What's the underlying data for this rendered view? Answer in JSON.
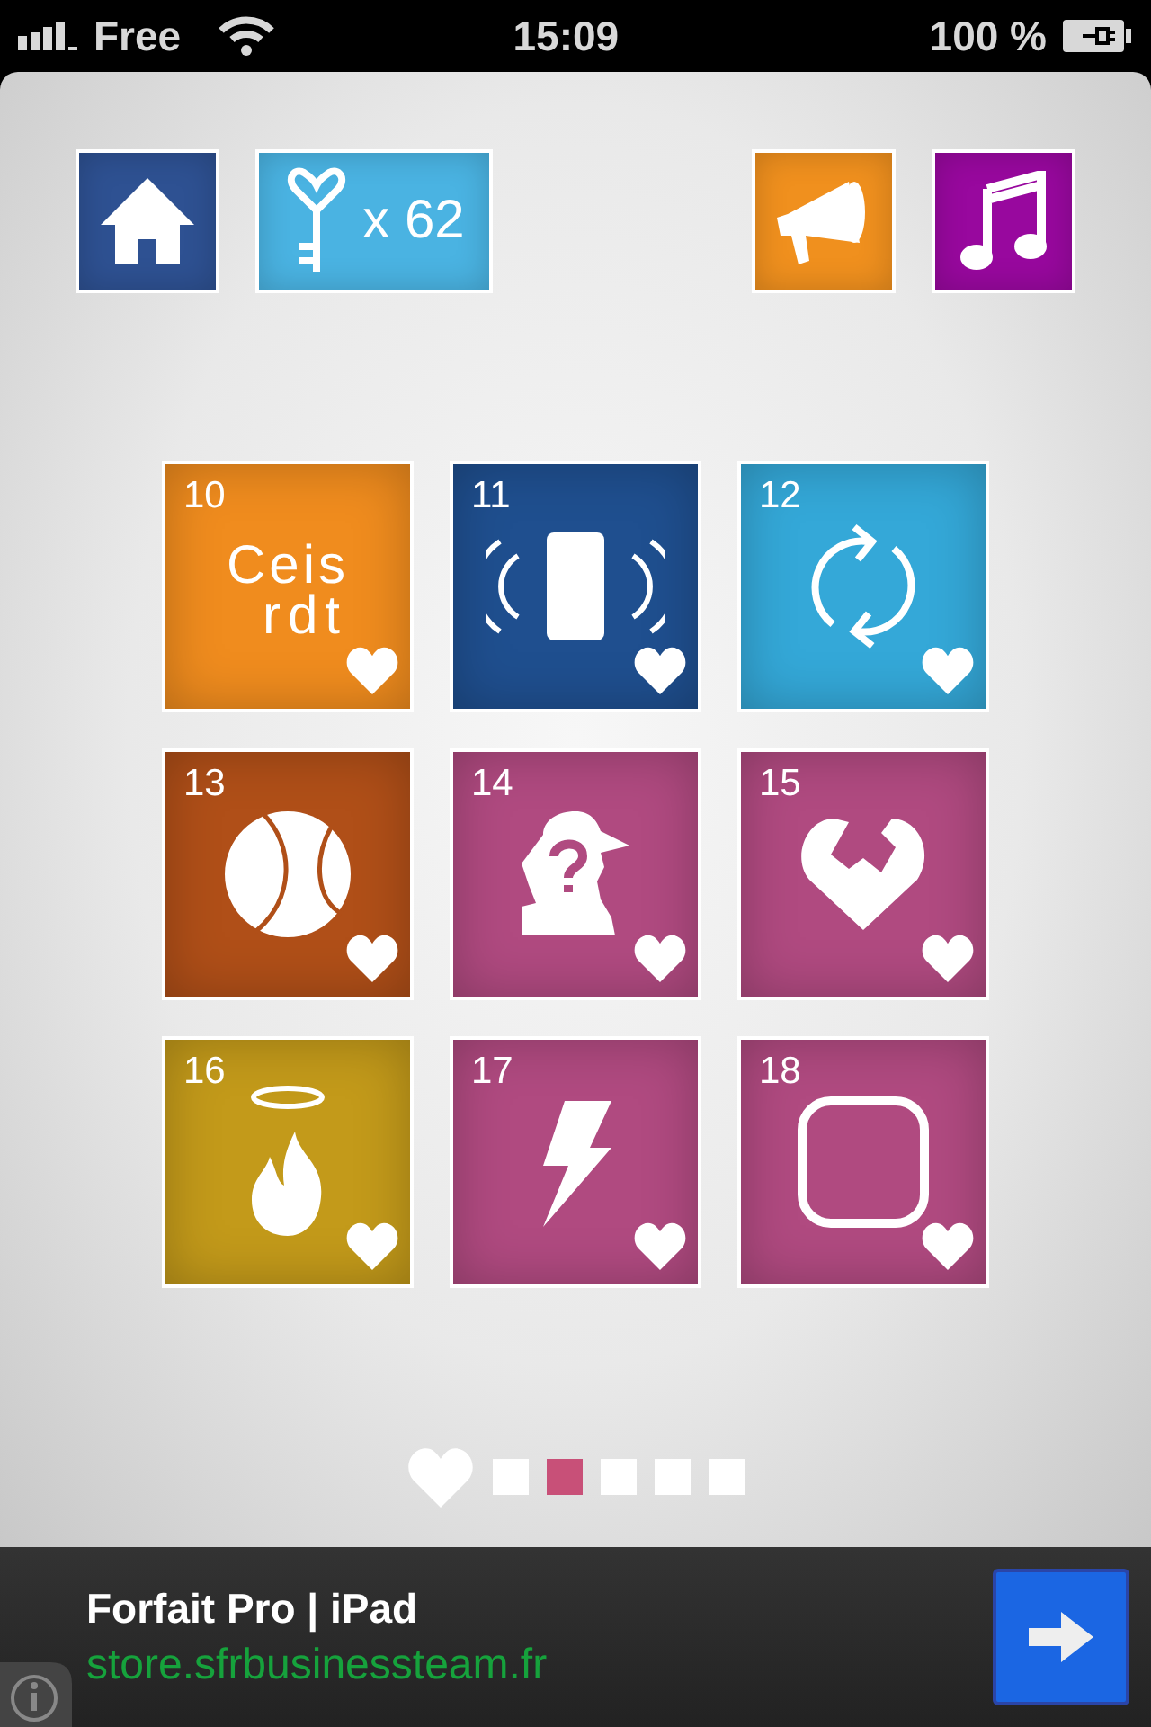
{
  "status_bar": {
    "carrier": "Free",
    "time": "15:09",
    "battery": "100 %"
  },
  "toolbar": {
    "left": [
      {
        "kind": "home",
        "color": "#2e5192"
      },
      {
        "kind": "keys",
        "color": "#4ab3e2",
        "count": "x 62"
      }
    ],
    "right": [
      {
        "kind": "megaphone",
        "color": "#f0901e"
      },
      {
        "kind": "music",
        "color": "#98089e"
      }
    ]
  },
  "tiles": [
    {
      "number": "10",
      "kind": "letters",
      "color": "#f08c1e",
      "letters": [
        "Ceis",
        "rdt"
      ]
    },
    {
      "number": "11",
      "kind": "vibrate",
      "color": "#1f4f8f"
    },
    {
      "number": "12",
      "kind": "cycle",
      "color": "#34a8d8"
    },
    {
      "number": "13",
      "kind": "ball",
      "color": "#b04f18"
    },
    {
      "number": "14",
      "kind": "detective",
      "color": "#b04a80"
    },
    {
      "number": "15",
      "kind": "broken-heart",
      "color": "#b04a80"
    },
    {
      "number": "16",
      "kind": "halo-fire",
      "color": "#c39a1a"
    },
    {
      "number": "17",
      "kind": "lightning",
      "color": "#b04a80"
    },
    {
      "number": "18",
      "kind": "rounded-square",
      "color": "#b04a80"
    }
  ],
  "pager": [
    {
      "kind": "heart",
      "selected": false
    },
    {
      "kind": "dot",
      "selected": false
    },
    {
      "kind": "dot",
      "selected": true
    },
    {
      "kind": "dot",
      "selected": false
    },
    {
      "kind": "dot",
      "selected": false
    },
    {
      "kind": "dot",
      "selected": false
    }
  ],
  "ad": {
    "title": "Forfait Pro | iPad",
    "url": "store.sfrbusinessteam.fr"
  }
}
